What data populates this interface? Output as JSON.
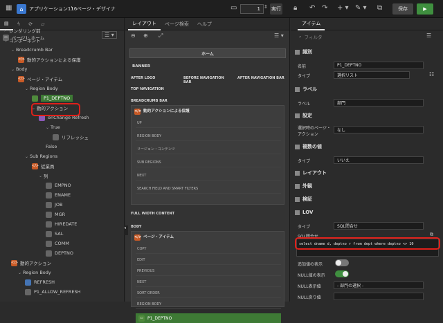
{
  "topbar": {
    "breadcrumb_app": "アプリケーション116",
    "breadcrumb_page": "ページ・デザイナ",
    "page_number": "1",
    "run_label": "実行",
    "save_label": "保存"
  },
  "left": {
    "root": "ページ1: ホーム",
    "tree": [
      {
        "label": "レンダリング前",
        "indent": 0,
        "icon": "caret"
      },
      {
        "label": "コンポーネント",
        "indent": 0,
        "icon": "caret-open"
      },
      {
        "label": "Breadcrumb Bar",
        "indent": 1,
        "icon": "caret-open"
      },
      {
        "label": "動的アクションによる保護",
        "indent": 2,
        "icon": "orange"
      },
      {
        "label": "Body",
        "indent": 1,
        "icon": "caret-open"
      },
      {
        "label": "ページ・アイテム",
        "indent": 2,
        "icon": "orange"
      },
      {
        "label": "Region Body",
        "indent": 3,
        "icon": "caret-open"
      },
      {
        "label": "P1_DEPTNO",
        "indent": 4,
        "icon": "green"
      },
      {
        "label": "動的アクション",
        "indent": 4,
        "icon": "caret-open"
      },
      {
        "label": "onChange Refresh",
        "indent": 5,
        "icon": "purple"
      },
      {
        "label": "True",
        "indent": 6,
        "icon": "caret-open"
      },
      {
        "label": "リフレッシュ",
        "indent": 7,
        "icon": "grey"
      },
      {
        "label": "False",
        "indent": 6,
        "icon": "none"
      },
      {
        "label": "Sub Regions",
        "indent": 3,
        "icon": "caret-open"
      },
      {
        "label": "従業員",
        "indent": 4,
        "icon": "orange"
      },
      {
        "label": "列",
        "indent": 5,
        "icon": "caret-open"
      },
      {
        "label": "EMPNO",
        "indent": 6,
        "icon": "grey"
      },
      {
        "label": "ENAME",
        "indent": 6,
        "icon": "grey"
      },
      {
        "label": "JOB",
        "indent": 6,
        "icon": "grey"
      },
      {
        "label": "MGR",
        "indent": 6,
        "icon": "grey"
      },
      {
        "label": "HIREDATE",
        "indent": 6,
        "icon": "grey"
      },
      {
        "label": "SAL",
        "indent": 6,
        "icon": "grey"
      },
      {
        "label": "COMM",
        "indent": 6,
        "icon": "grey"
      },
      {
        "label": "DEPTNO",
        "indent": 6,
        "icon": "grey"
      },
      {
        "label": "動的アクション",
        "indent": 1,
        "icon": "orange"
      },
      {
        "label": "Region Body",
        "indent": 2,
        "icon": "caret-open"
      },
      {
        "label": "REFRESH",
        "indent": 3,
        "icon": "blue"
      },
      {
        "label": "P1_ALLOW_REFRESH",
        "indent": 3,
        "icon": "grey"
      }
    ]
  },
  "mid": {
    "tabs": [
      "レイアウト",
      "ページ検索",
      "ヘルプ"
    ],
    "home_label": "ホーム",
    "banner": "BANNER",
    "after_logo": "AFTER LOGO",
    "before_nav": "BEFORE NAVIGATION BAR",
    "after_nav": "AFTER NAVIGATION BAR",
    "top_nav": "TOP NAVIGATION",
    "breadcrumb_bar": "BREADCRUMB BAR",
    "region1_title": "動的アクションによる保護",
    "region1_slots": [
      "UP",
      "REGION BODY",
      "リージョン・コンテンツ",
      "SUB REGIONS",
      "NEXT",
      "SEARCH FIELD AND SMART FILTERS"
    ],
    "full_width": "FULL WIDTH CONTENT",
    "body": "BODY",
    "region2_title": "ページ・アイテム",
    "region2_slots": [
      "COPY",
      "EDIT",
      "PREVIOUS",
      "NEXT",
      "SORT ORDER",
      "REGION BODY"
    ],
    "item_label": "P1_DEPTNO"
  },
  "right": {
    "tab": "アイテム",
    "filter_placeholder": "フィルタ",
    "sections": {
      "identification": "識別",
      "label": "ラベル",
      "settings": "設定",
      "multiple": "複数の値",
      "layout": "レイアウト",
      "appearance": "外観",
      "validation": "検証",
      "lov": "LOV"
    },
    "name_label": "名前",
    "name_value": "P1_DEPTNO",
    "type_label": "タイプ",
    "type_value": "選択リスト",
    "label_label": "ラベル",
    "label_value": "部門",
    "page_action_label": "選択時のページ・アクション",
    "page_action_value": "なし",
    "multi_type_label": "タイプ",
    "multi_type_value": "いいえ",
    "lov_type_label": "タイプ",
    "lov_type_value": "SQL問合せ",
    "sql_label": "SQL問合せ",
    "sql_value": "select dname d, deptno r from dept where deptno <> 10",
    "extra_label": "追加値の表示",
    "null_display_label": "NULL値の表示",
    "null_value_label": "NULL表示値",
    "null_value": "- 部門の選択 -",
    "null_return_label": "NULL戻り値"
  },
  "colors": {
    "highlight": "#e0201a",
    "save_green": "#3f8f3f"
  }
}
